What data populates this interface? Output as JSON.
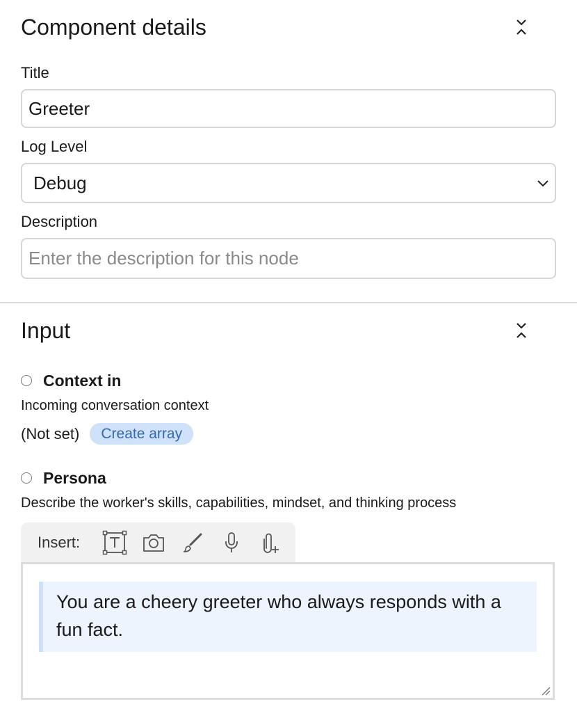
{
  "component_details": {
    "title": "Component details",
    "fields": {
      "title_label": "Title",
      "title_value": "Greeter",
      "log_level_label": "Log Level",
      "log_level_value": "Debug",
      "description_label": "Description",
      "description_placeholder": "Enter the description for this node"
    }
  },
  "input_section": {
    "title": "Input",
    "context_in": {
      "label": "Context in",
      "description": "Incoming conversation context",
      "status": "(Not set)",
      "action_label": "Create array"
    },
    "persona": {
      "label": "Persona",
      "description": "Describe the worker's skills, capabilities, mindset, and thinking process",
      "toolbar_label": "Insert:",
      "toolbar_icons": [
        "text-box-icon",
        "camera-icon",
        "brush-icon",
        "microphone-icon",
        "attachment-add-icon"
      ],
      "content": "You are a cheery greeter who always responds with a fun fact."
    }
  },
  "colors": {
    "pill_bg": "#cfe2fa",
    "pill_text": "#3568b6",
    "quote_bg": "#edf4fd",
    "quote_border": "#cde0f7"
  }
}
